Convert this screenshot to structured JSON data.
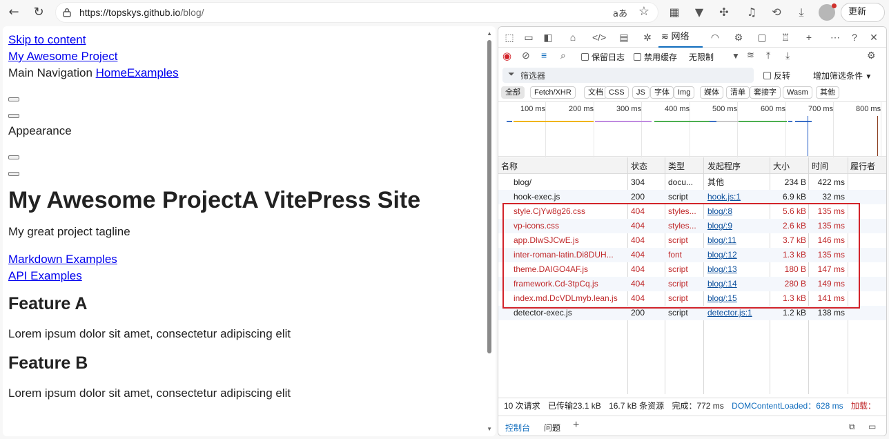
{
  "browser": {
    "url_host": "https://topskys.github.io",
    "url_path": "/blog/",
    "update_label": "更新",
    "read_aloud": "aあ"
  },
  "page": {
    "skip_link": "Skip to content",
    "site_link": "My Awesome Project",
    "nav_label": "Main Navigation",
    "nav_home": "Home",
    "nav_examples": "Examples",
    "appearance": "Appearance",
    "heading": "My Awesome ProjectA VitePress Site",
    "tagline": "My great project tagline",
    "link_markdown": "Markdown Examples",
    "link_api": "API Examples",
    "feature_a_title": "Feature A",
    "feature_a_text": "Lorem ipsum dolor sit amet, consectetur adipiscing elit",
    "feature_b_title": "Feature B",
    "feature_b_text": "Lorem ipsum dolor sit amet, consectetur adipiscing elit"
  },
  "devtools": {
    "network_tab": "网络",
    "preserve_log": "保留日志",
    "disable_cache": "禁用缓存",
    "throttle": "无限制",
    "filter_placeholder": "筛选器",
    "invert": "反转",
    "more_filters": "增加筛选条件",
    "type_filters": [
      "全部",
      "Fetch/XHR",
      "文档",
      "CSS",
      "JS",
      "字体",
      "Img",
      "媒体",
      "清单",
      "套接字",
      "Wasm",
      "其他"
    ],
    "timeline_ticks": [
      "100 ms",
      "200 ms",
      "300 ms",
      "400 ms",
      "500 ms",
      "600 ms",
      "700 ms",
      "800 ms"
    ],
    "columns": [
      "名称",
      "状态",
      "类型",
      "发起程序",
      "大小",
      "时间",
      "履行者"
    ],
    "rows": [
      {
        "name": "blog/",
        "status": "304",
        "type": "docu...",
        "initiator": "其他",
        "size": "234 B",
        "time": "422 ms",
        "error": false,
        "initiator_link": false
      },
      {
        "name": "hook-exec.js",
        "status": "200",
        "type": "script",
        "initiator": "hook.js:1",
        "size": "6.9 kB",
        "time": "32 ms",
        "error": false,
        "initiator_link": true
      },
      {
        "name": "style.CjYw8g26.css",
        "status": "404",
        "type": "styles...",
        "initiator": "blog/:8",
        "size": "5.6 kB",
        "time": "135 ms",
        "error": true,
        "initiator_link": true
      },
      {
        "name": "vp-icons.css",
        "status": "404",
        "type": "styles...",
        "initiator": "blog/:9",
        "size": "2.6 kB",
        "time": "135 ms",
        "error": true,
        "initiator_link": true
      },
      {
        "name": "app.DlwSJCwE.js",
        "status": "404",
        "type": "script",
        "initiator": "blog/:11",
        "size": "3.7 kB",
        "time": "146 ms",
        "error": true,
        "initiator_link": true
      },
      {
        "name": "inter-roman-latin.Di8DUH...",
        "status": "404",
        "type": "font",
        "initiator": "blog/:12",
        "size": "1.3 kB",
        "time": "135 ms",
        "error": true,
        "initiator_link": true
      },
      {
        "name": "theme.DAIGO4AF.js",
        "status": "404",
        "type": "script",
        "initiator": "blog/:13",
        "size": "180 B",
        "time": "147 ms",
        "error": true,
        "initiator_link": true
      },
      {
        "name": "framework.Cd-3tpCq.js",
        "status": "404",
        "type": "script",
        "initiator": "blog/:14",
        "size": "280 B",
        "time": "149 ms",
        "error": true,
        "initiator_link": true
      },
      {
        "name": "index.md.DcVDLmyb.lean.js",
        "status": "404",
        "type": "script",
        "initiator": "blog/:15",
        "size": "1.3 kB",
        "time": "141 ms",
        "error": true,
        "initiator_link": true
      },
      {
        "name": "detector-exec.js",
        "status": "200",
        "type": "script",
        "initiator": "detector.js:1",
        "size": "1.2 kB",
        "time": "138 ms",
        "error": false,
        "initiator_link": true
      }
    ],
    "summary": {
      "requests": "10 次请求",
      "transferred": "已传输23.1 kB",
      "resources": "16.7 kB 条资源",
      "finish": "完成：772 ms",
      "dcl": "DOMContentLoaded：628 ms",
      "load": "加载："
    },
    "drawer_console": "控制台",
    "drawer_issues": "问题"
  }
}
